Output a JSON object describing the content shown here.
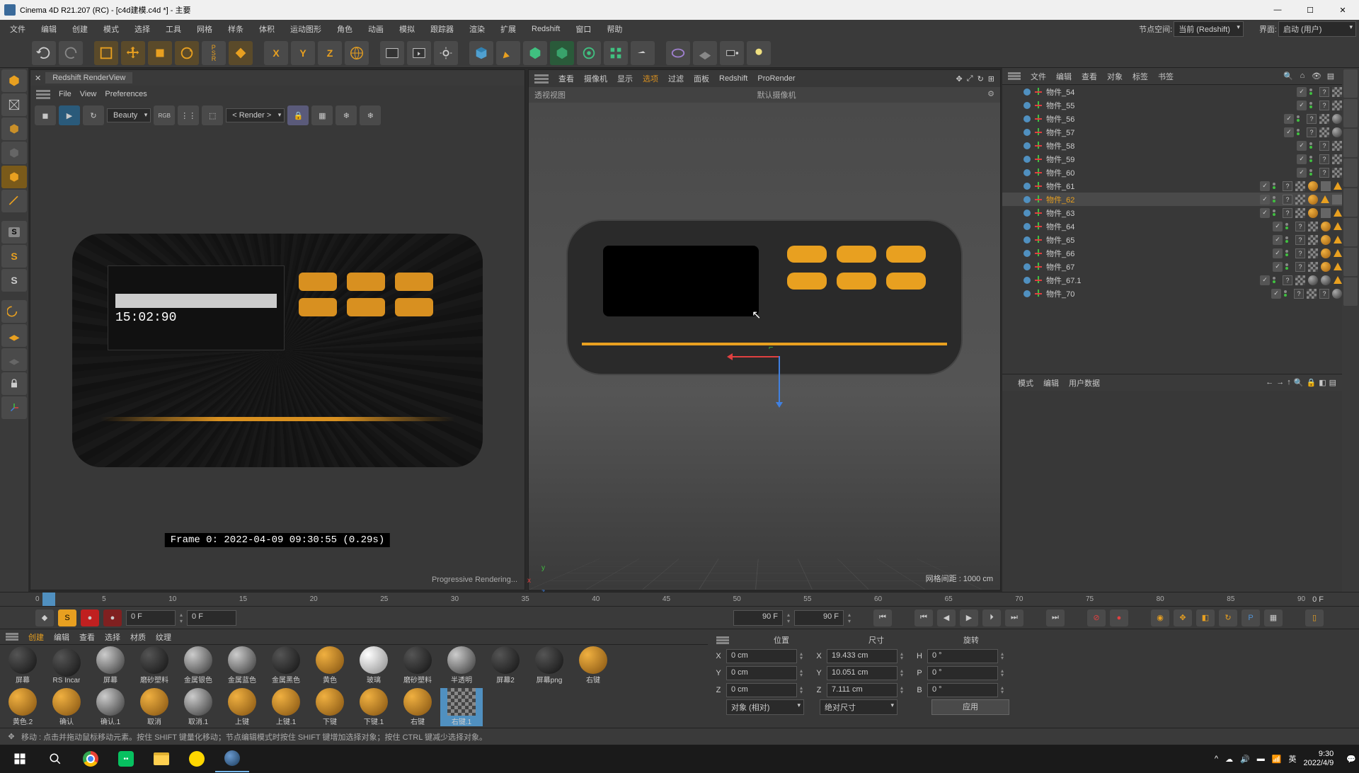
{
  "titlebar": {
    "title": "Cinema 4D R21.207 (RC) - [c4d建模.c4d *] - 主要"
  },
  "menubar": {
    "items": [
      "文件",
      "编辑",
      "创建",
      "模式",
      "选择",
      "工具",
      "网格",
      "样条",
      "体积",
      "运动图形",
      "角色",
      "动画",
      "模拟",
      "跟踪器",
      "渲染",
      "扩展",
      "Redshift",
      "窗口",
      "帮助"
    ],
    "node_label": "节点空间:",
    "node_value": "当前 (Redshift)",
    "iface_label": "界面:",
    "iface_value": "启动 (用户)"
  },
  "render_panel": {
    "tab": "Redshift RenderView",
    "menu": [
      "File",
      "View",
      "Preferences"
    ],
    "mode": "Beauty",
    "render_dd": "< Render >",
    "screen_time": "15:02:90",
    "frame_text": "Frame  0:  2022-04-09  09:30:55  (0.29s)",
    "status": "Progressive Rendering..."
  },
  "viewport": {
    "menu": [
      "查看",
      "摄像机",
      "显示",
      "选项",
      "过滤",
      "面板",
      "Redshift",
      "ProRender"
    ],
    "view_name": "透视视图",
    "camera": "默认摄像机",
    "grid_info": "网格间距 : 1000 cm"
  },
  "objmgr": {
    "tabs": [
      "文件",
      "编辑",
      "查看",
      "对象",
      "标签",
      "书签"
    ],
    "items": [
      {
        "name": "物件_54",
        "extras": [
          "q",
          "c"
        ]
      },
      {
        "name": "物件_55",
        "extras": [
          "q",
          "c"
        ]
      },
      {
        "name": "物件_56",
        "extras": [
          "q",
          "c",
          "sg"
        ]
      },
      {
        "name": "物件_57",
        "extras": [
          "q",
          "c",
          "sg"
        ]
      },
      {
        "name": "物件_58",
        "extras": [
          "q",
          "c"
        ]
      },
      {
        "name": "物件_59",
        "extras": [
          "q",
          "c"
        ]
      },
      {
        "name": "物件_60",
        "extras": [
          "q",
          "c"
        ]
      },
      {
        "name": "物件_61",
        "extras": [
          "q",
          "c",
          "s",
          "sq",
          "t"
        ]
      },
      {
        "name": "物件_62",
        "sel": true,
        "extras": [
          "q",
          "c",
          "s",
          "t",
          "sq"
        ]
      },
      {
        "name": "物件_63",
        "extras": [
          "q",
          "c",
          "s",
          "sq",
          "t"
        ]
      },
      {
        "name": "物件_64",
        "extras": [
          "q",
          "c",
          "s",
          "t"
        ]
      },
      {
        "name": "物件_65",
        "extras": [
          "q",
          "c",
          "s",
          "t"
        ]
      },
      {
        "name": "物件_66",
        "extras": [
          "q",
          "c",
          "s",
          "t"
        ]
      },
      {
        "name": "物件_67",
        "extras": [
          "q",
          "c",
          "s",
          "t"
        ]
      },
      {
        "name": "物件_67.1",
        "extras": [
          "q",
          "c",
          "sg",
          "sg",
          "t"
        ]
      },
      {
        "name": "物件_70",
        "extras": [
          "q",
          "c",
          "q",
          "sg"
        ]
      }
    ]
  },
  "attrmgr": {
    "tabs": [
      "模式",
      "编辑",
      "用户数据"
    ]
  },
  "timeline": {
    "ticks": [
      "0",
      "5",
      "10",
      "15",
      "20",
      "25",
      "30",
      "35",
      "40",
      "45",
      "50",
      "55",
      "60",
      "65",
      "70",
      "75",
      "80",
      "85",
      "90"
    ],
    "end": "0 F"
  },
  "playback": {
    "cur": "0 F",
    "cur2": "0 F",
    "max": "90 F",
    "max2": "90 F"
  },
  "materials": {
    "tabs": [
      "创建",
      "编辑",
      "查看",
      "选择",
      "材质",
      "纹理"
    ],
    "row1": [
      {
        "label": "屏幕",
        "type": "d"
      },
      {
        "label": "RS Incar",
        "type": "d"
      },
      {
        "label": "屏幕",
        "type": "g"
      },
      {
        "label": "磨砂塑料",
        "type": "d"
      },
      {
        "label": "金属银色",
        "type": "g"
      },
      {
        "label": "金属蓝色",
        "type": "g"
      },
      {
        "label": "金属黑色",
        "type": "d"
      },
      {
        "label": "黄色",
        "type": "o"
      },
      {
        "label": "玻璃",
        "type": "w"
      },
      {
        "label": "磨砂塑料",
        "type": "d"
      },
      {
        "label": "半透明",
        "type": "g"
      },
      {
        "label": "屏幕2",
        "type": "d"
      },
      {
        "label": "屏幕png",
        "type": "d"
      },
      {
        "label": "右键",
        "type": "o"
      }
    ],
    "row2": [
      {
        "label": "黄色.2",
        "type": "o"
      },
      {
        "label": "确认",
        "type": "o"
      },
      {
        "label": "确认.1",
        "type": "g"
      },
      {
        "label": "取消",
        "type": "o"
      },
      {
        "label": "取消.1",
        "type": "g"
      },
      {
        "label": "上键",
        "type": "o"
      },
      {
        "label": "上键.1",
        "type": "o"
      },
      {
        "label": "下键",
        "type": "o"
      },
      {
        "label": "下键.1",
        "type": "o"
      },
      {
        "label": "右键",
        "type": "o"
      },
      {
        "label": "右键.1",
        "type": "c",
        "sel": true
      }
    ]
  },
  "coords": {
    "headers": [
      "位置",
      "尺寸",
      "旋转"
    ],
    "rows": [
      {
        "a": "X",
        "v1": "0 cm",
        "b": "X",
        "v2": "19.433 cm",
        "c": "H",
        "v3": "0 °"
      },
      {
        "a": "Y",
        "v1": "0 cm",
        "b": "Y",
        "v2": "10.051 cm",
        "c": "P",
        "v3": "0 °"
      },
      {
        "a": "Z",
        "v1": "0 cm",
        "b": "Z",
        "v2": "7.111 cm",
        "c": "B",
        "v3": "0 °"
      }
    ],
    "dd1": "对象 (相对)",
    "dd2": "绝对尺寸",
    "apply": "应用"
  },
  "statusbar": {
    "text": "移动 : 点击并拖动鼠标移动元素。按住 SHIFT 键量化移动；节点编辑模式时按住 SHIFT 键增加选择对象；按住 CTRL 键减少选择对象。"
  },
  "taskbar": {
    "time": "9:30",
    "date": "2022/4/9",
    "lang": "英"
  }
}
